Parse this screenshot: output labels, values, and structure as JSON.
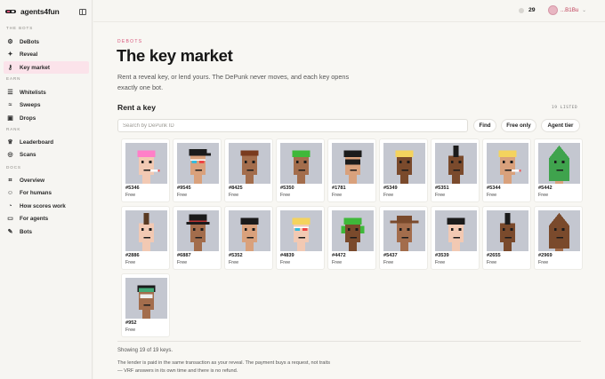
{
  "sidebar": {
    "brand": "agents4fun",
    "sections": [
      {
        "label": "THE BOTS",
        "items": [
          {
            "label": "DeBots",
            "icon": "bot-icon"
          },
          {
            "label": "Reveal",
            "icon": "sparkle-icon"
          },
          {
            "label": "Key market",
            "icon": "key-icon",
            "active": true
          }
        ]
      },
      {
        "label": "EARN",
        "items": [
          {
            "label": "Whitelists",
            "icon": "list-icon"
          },
          {
            "label": "Sweeps",
            "icon": "waves-icon"
          },
          {
            "label": "Drops",
            "icon": "inbox-icon"
          }
        ]
      },
      {
        "label": "RANK",
        "items": [
          {
            "label": "Leaderboard",
            "icon": "trophy-icon"
          },
          {
            "label": "Scans",
            "icon": "scan-icon"
          }
        ]
      },
      {
        "label": "DOCS",
        "items": [
          {
            "label": "Overview",
            "icon": "overview-icon"
          },
          {
            "label": "For humans",
            "icon": "people-icon"
          },
          {
            "label": "How scores work",
            "icon": "gauge-icon"
          },
          {
            "label": "For agents",
            "icon": "folder-icon"
          },
          {
            "label": "Bots",
            "icon": "pen-icon"
          }
        ]
      }
    ]
  },
  "topbar": {
    "points": "29",
    "user": "...B1Bu"
  },
  "page": {
    "eyebrow": "DEBOTS",
    "title": "The key market",
    "lede": "Rent a reveal key, or lend yours. The DePunk never moves, and each key opens exactly one bot.",
    "section_title": "Rent a key",
    "listed": "19 LISTED",
    "search_placeholder": "Search by DePunk ID",
    "buttons": {
      "find": "Find",
      "free_only": "Free only",
      "agent_tier": "Agent tier"
    },
    "showing": "Showing 19 of 19 keys.",
    "footnote": "The lender is paid in the same transaction as your reveal. The payment buys a request, not traits — VRF answers in its own time and there is no refund."
  },
  "cards": [
    {
      "id": "#5346",
      "price": "Free",
      "skin": "#f2c9b3",
      "hair": "#ff7fc8",
      "bg": "#c4c7d0",
      "acc": "cig"
    },
    {
      "id": "#9545",
      "price": "Free",
      "skin": "#d9a17c",
      "hair": "#1b1b1b",
      "bg": "#c4c7d0",
      "acc": "cap3d"
    },
    {
      "id": "#8425",
      "price": "Free",
      "skin": "#a36d4c",
      "hair": "#7a3b1e",
      "bg": "#c4c7d0",
      "acc": "bandana"
    },
    {
      "id": "#5350",
      "price": "Free",
      "skin": "#a36d4c",
      "hair": "#3fb83a",
      "bg": "#c4c7d0",
      "acc": "none"
    },
    {
      "id": "#1781",
      "price": "Free",
      "skin": "#d9a17c",
      "hair": "#1b1b1b",
      "bg": "#c4c7d0",
      "acc": "mask"
    },
    {
      "id": "#5349",
      "price": "Free",
      "skin": "#7a4a2c",
      "hair": "#f4d35e",
      "bg": "#c4c7d0",
      "acc": "none"
    },
    {
      "id": "#5351",
      "price": "Free",
      "skin": "#7a4a2c",
      "hair": "#1b1b1b",
      "bg": "#c4c7d0",
      "acc": "mohawk"
    },
    {
      "id": "#5344",
      "price": "Free",
      "skin": "#d9a17c",
      "hair": "#f4d35e",
      "bg": "#c4c7d0",
      "acc": "cig"
    },
    {
      "id": "#5442",
      "price": "Free",
      "skin": "#d9a17c",
      "hair": "#3fa34d",
      "bg": "#c4c7d0",
      "acc": "hood"
    },
    {
      "id": "#2886",
      "price": "Free",
      "skin": "#f2c9b3",
      "hair": "#5a3a22",
      "bg": "#c4c7d0",
      "acc": "mohawk"
    },
    {
      "id": "#6887",
      "price": "Free",
      "skin": "#a36d4c",
      "hair": "#1b1b1b",
      "bg": "#c4c7d0",
      "acc": "tophat"
    },
    {
      "id": "#5352",
      "price": "Free",
      "skin": "#d9a17c",
      "hair": "#1b1b1b",
      "bg": "#c4c7d0",
      "acc": "none"
    },
    {
      "id": "#4839",
      "price": "Free",
      "skin": "#f2c9b3",
      "hair": "#f4d35e",
      "bg": "#c4c7d0",
      "acc": "glasses3d"
    },
    {
      "id": "#4472",
      "price": "Free",
      "skin": "#7a4a2c",
      "hair": "#3fb83a",
      "bg": "#c4c7d0",
      "acc": "headphones"
    },
    {
      "id": "#5437",
      "price": "Free",
      "skin": "#a36d4c",
      "hair": "#7a4a2c",
      "bg": "#c4c7d0",
      "acc": "cowboy"
    },
    {
      "id": "#3539",
      "price": "Free",
      "skin": "#f2c9b3",
      "hair": "#1b1b1b",
      "bg": "#c4c7d0",
      "acc": "none"
    },
    {
      "id": "#2655",
      "price": "Free",
      "skin": "#7a4a2c",
      "hair": "#1b1b1b",
      "bg": "#c4c7d0",
      "acc": "mohawk"
    },
    {
      "id": "#2969",
      "price": "Free",
      "skin": "#a36d4c",
      "hair": "#7a4a2c",
      "bg": "#c4c7d0",
      "acc": "hood"
    },
    {
      "id": "#952",
      "price": "Free",
      "skin": "#a36d4c",
      "hair": "#1b1b1b",
      "bg": "#c4c7d0",
      "acc": "goggles"
    }
  ]
}
